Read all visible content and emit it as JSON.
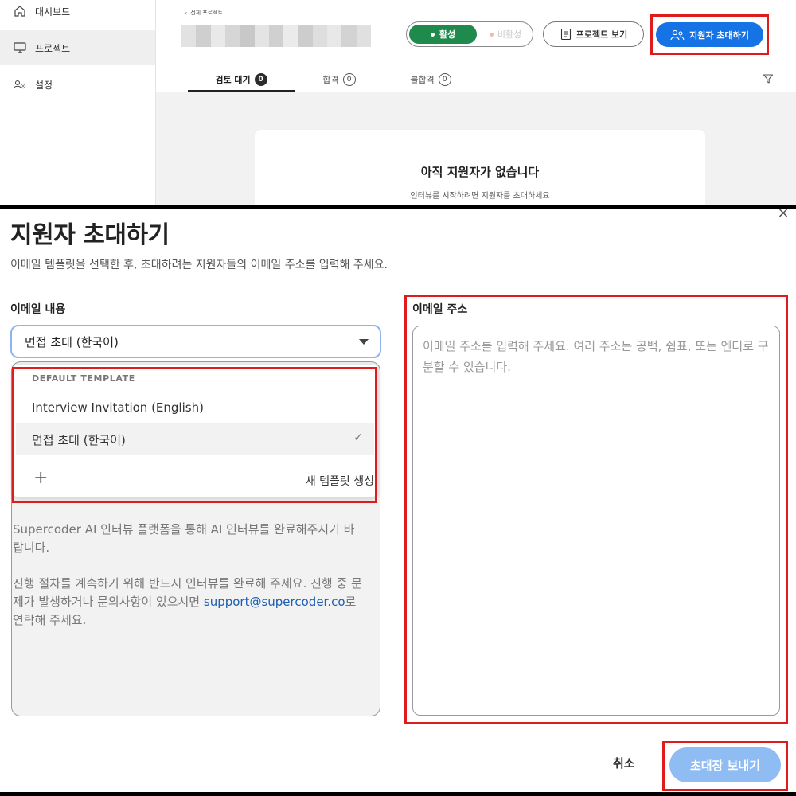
{
  "sidebar": {
    "items": [
      {
        "label": "대시보드",
        "icon": "home-icon"
      },
      {
        "label": "프로젝트",
        "icon": "monitor-icon"
      },
      {
        "label": "설정",
        "icon": "users-settings-icon"
      }
    ]
  },
  "header": {
    "breadcrumb": "전체 프로젝트",
    "status_toggle": {
      "active_label": "활성",
      "inactive_label": "비활성"
    },
    "view_project_label": "프로젝트 보기",
    "invite_label": "지원자 초대하기"
  },
  "tabs": [
    {
      "label": "검토 대기",
      "count": "0"
    },
    {
      "label": "합격",
      "count": "0"
    },
    {
      "label": "불합격",
      "count": "0"
    }
  ],
  "empty_state": {
    "title": "아직 지원자가 없습니다",
    "subtitle": "인터뷰를 시작하려면 지원자를 초대하세요"
  },
  "modal": {
    "title": "지원자 초대하기",
    "subtitle": "이메일 템플릿을 선택한 후, 초대하려는 지원자들의 이메일 주소를 입력해 주세요.",
    "email_content_label": "이메일 내용",
    "selected_template": "면접 초대 (한국어)",
    "dropdown": {
      "section_header": "DEFAULT TEMPLATE",
      "options": [
        "Interview Invitation (English)",
        "면접 초대 (한국어)"
      ],
      "new_template_label": "새 템플릿 생성"
    },
    "content_text": {
      "p1": "Supercoder AI 인터뷰 플랫폼을 통해 AI 인터뷰를 완료해주시기 바랍니다.",
      "p2a": "진행 절차를 계속하기 위해 반드시 인터뷰를 완료해 주세요. 진행 중 문제가 발생하거나 문의사항이 있으시면 ",
      "link": "support@supercoder.co",
      "p2b": "로 연락해 주세요."
    },
    "email_address_label": "이메일 주소",
    "email_placeholder": "이메일 주소를 입력해 주세요. 여러 주소는 공백, 쉼표, 또는 엔터로 구분할 수 있습니다.",
    "cancel_label": "취소",
    "send_label": "초대장 보내기"
  },
  "colors": {
    "active_green": "#1e8a4c",
    "primary_blue": "#1573e6",
    "disabled_blue": "#8fbcf2",
    "highlight_red": "#e01b1b"
  }
}
